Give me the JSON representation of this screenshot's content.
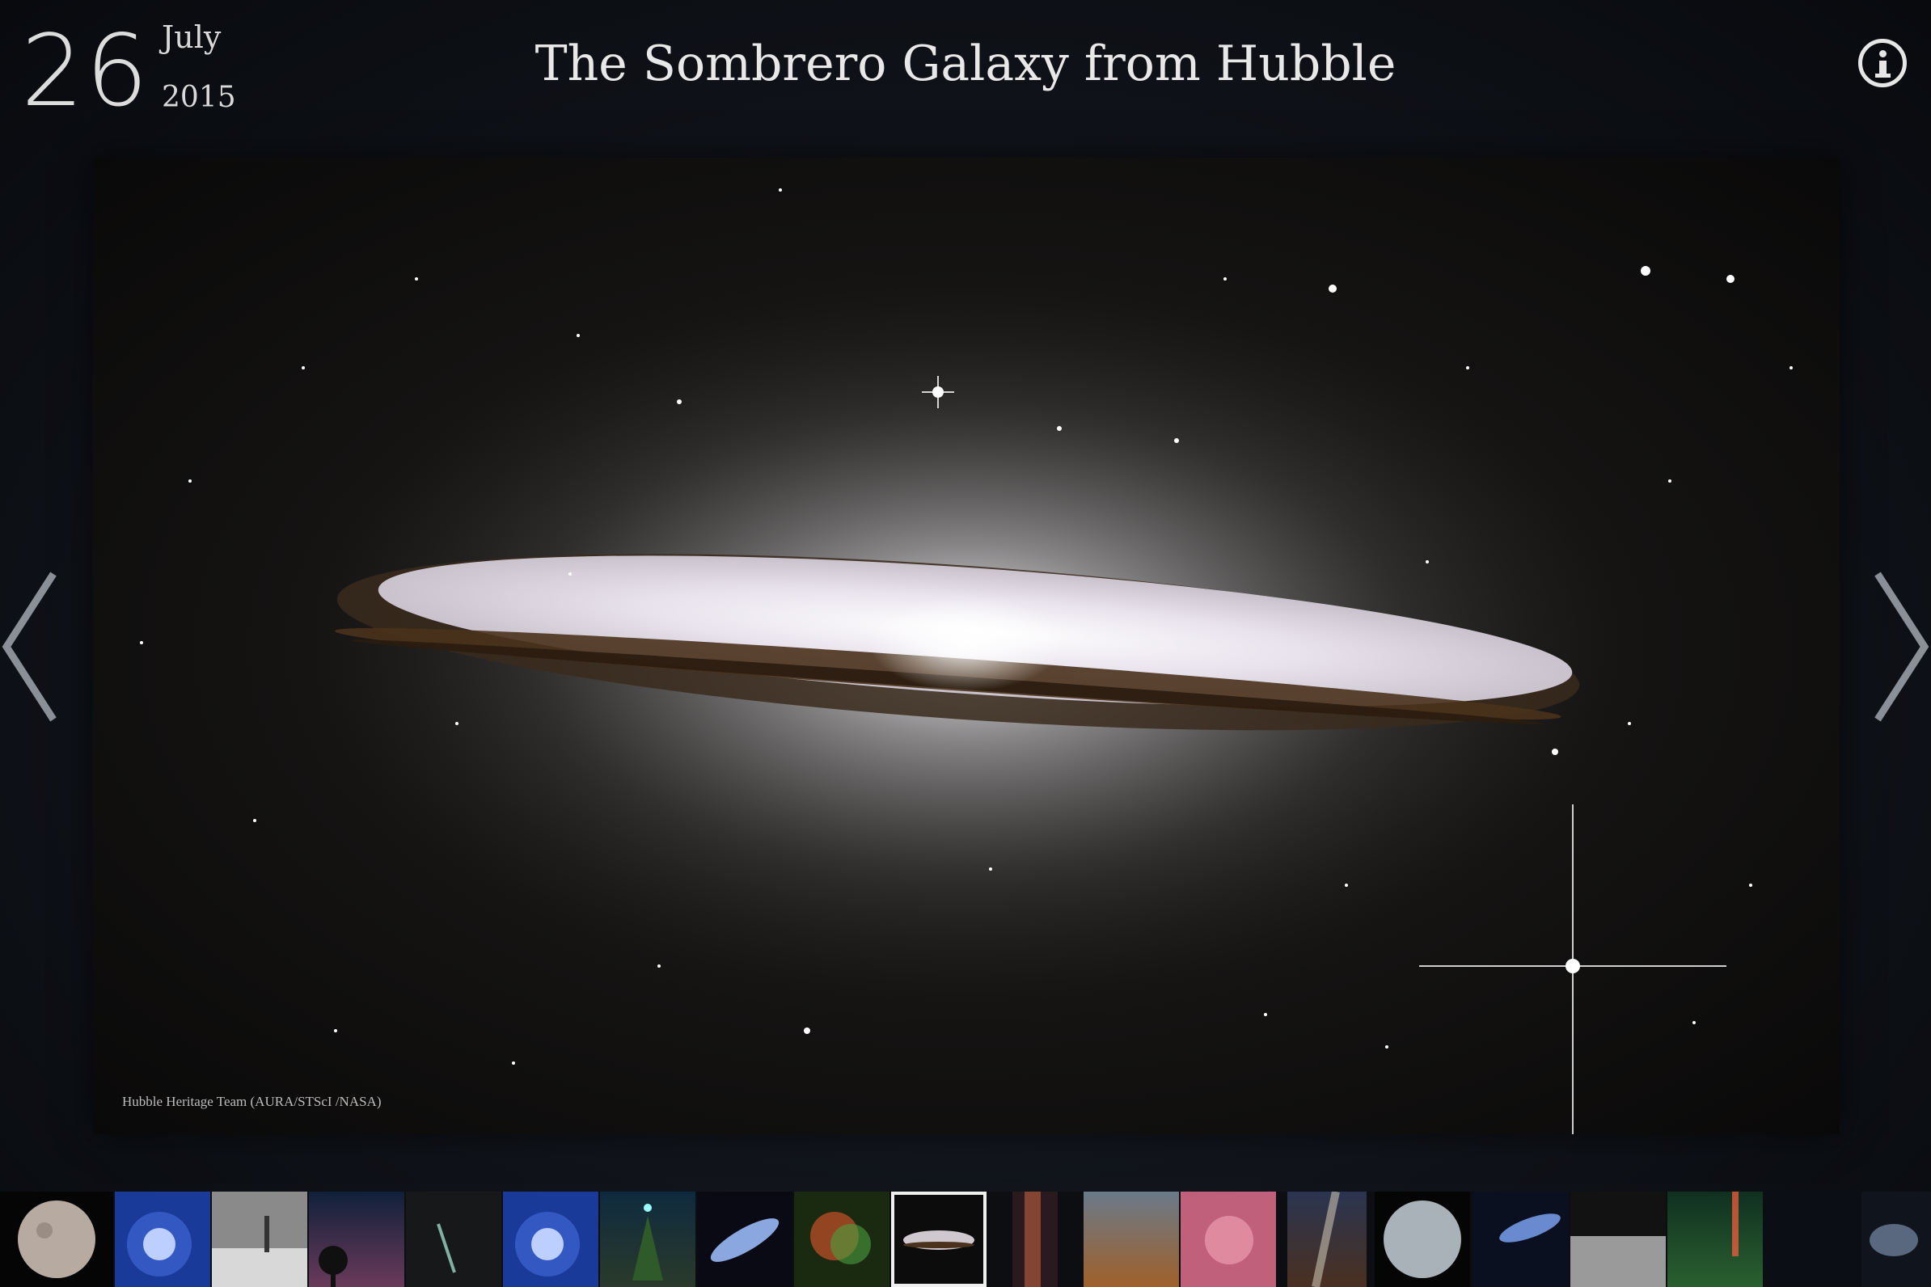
{
  "header": {
    "day": "26",
    "month": "July",
    "year": "2015",
    "title": "The Sombrero Galaxy from Hubble"
  },
  "icons": {
    "info": "info-icon",
    "prev": "chevron-left-icon",
    "next": "chevron-right-icon"
  },
  "image": {
    "credit": "Hubble Heritage Team (AURA/STScI /NASA)"
  },
  "filmstrip": {
    "selected_index": 9,
    "thumbnails": [
      {
        "subject": "planet"
      },
      {
        "subject": "bright-star"
      },
      {
        "subject": "observatory"
      },
      {
        "subject": "tree-silhouette"
      },
      {
        "subject": "comet"
      },
      {
        "subject": "bright-star"
      },
      {
        "subject": "tree-starlight"
      },
      {
        "subject": "galaxy"
      },
      {
        "subject": "nebula"
      },
      {
        "subject": "sombrero-galaxy"
      },
      {
        "subject": "nebula-column"
      },
      {
        "subject": "landscape"
      },
      {
        "subject": "pink-nebula"
      },
      {
        "subject": "milky-way"
      },
      {
        "subject": "moon"
      },
      {
        "subject": "galaxy-pair"
      },
      {
        "subject": "lunar-surface"
      },
      {
        "subject": "aurora"
      },
      {
        "subject": "star-field"
      },
      {
        "subject": "galaxy-partial"
      }
    ]
  },
  "colors": {
    "background": "#0f1218",
    "text": "#e6e6e6",
    "selected_border": "#f0f0f0"
  }
}
